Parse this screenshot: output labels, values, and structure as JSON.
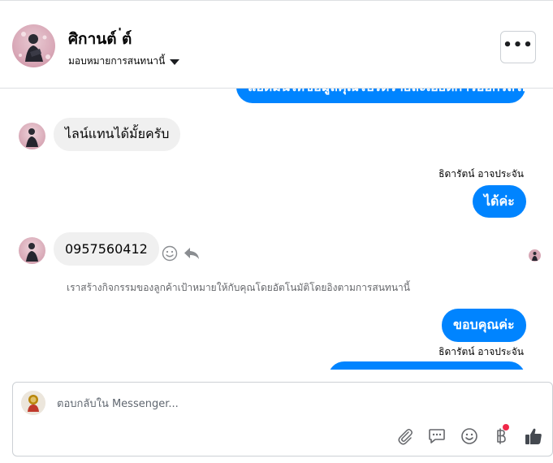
{
  "header": {
    "contact_name": "ศิกานต์ ่ต์",
    "assign_label": "มอบหมายการสนทนานี้",
    "more_label": "•••"
  },
  "messages": {
    "partial_top_text": "แอดมินให้ข้อมูลคุณโปรดรายละเอียดการออกรถให้คะ",
    "incoming_1": "ไลน์แทนได้มั้ยครับ",
    "sender_1": "ธิดารัตน์ อาจประจัน",
    "outgoing_1": "ได้ค่ะ",
    "incoming_2": "0957560412",
    "system_note": "เราสร้างกิจกรรมของลูกค้าเป้าหมายให้กับคุณโดยอัตโนมัติโดยอิงตามการสนทนานี้",
    "outgoing_2": "ขอบคุณค่ะ",
    "sender_2": "ธิดารัตน์ อาจประจัน"
  },
  "composer": {
    "placeholder": "ตอบกลับใน Messenger..."
  },
  "colors": {
    "accent": "#0084ff",
    "incoming_bubble": "#f0f0f0",
    "notification": "#f02849"
  },
  "icons": [
    "more-icon",
    "caret-down-icon",
    "smiley-icon",
    "reply-icon",
    "paperclip-icon",
    "chat-bubble-icon",
    "emoji-icon",
    "baht-icon",
    "thumbs-up-icon"
  ]
}
